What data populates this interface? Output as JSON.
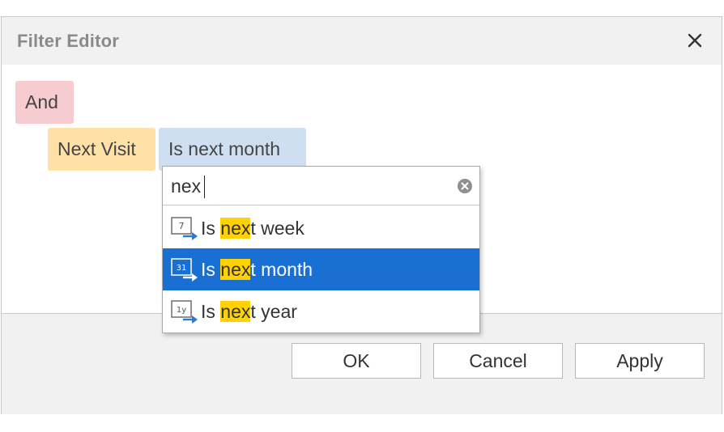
{
  "dialog": {
    "title": "Filter Editor"
  },
  "filter": {
    "group_operator": "And",
    "field": "Next Visit",
    "operator": "Is next month"
  },
  "search": {
    "value": "nex"
  },
  "options": [
    {
      "prefix": "Is ",
      "match": "nex",
      "suffix": "t week",
      "icon": "calendar-7-icon",
      "icon_text": "7",
      "selected": false
    },
    {
      "prefix": "Is ",
      "match": "nex",
      "suffix": "t month",
      "icon": "calendar-31-icon",
      "icon_text": "31",
      "selected": true
    },
    {
      "prefix": "Is ",
      "match": "nex",
      "suffix": "t year",
      "icon": "calendar-1y-icon",
      "icon_text": "1y",
      "selected": false
    }
  ],
  "buttons": {
    "ok": "OK",
    "cancel": "Cancel",
    "apply": "Apply"
  },
  "colors": {
    "group_token": "#f7ccd0",
    "field_token": "#fde1a6",
    "operator_token": "#cedff2",
    "selection": "#1a6fd3",
    "match_highlight": "#ffd200"
  }
}
